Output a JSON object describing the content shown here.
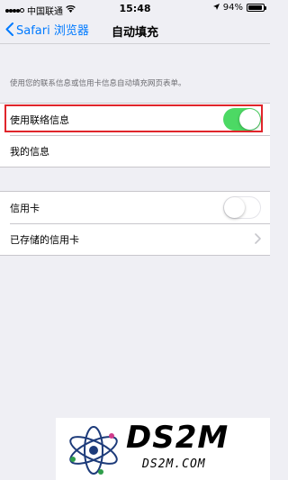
{
  "status": {
    "carrier": "中国联通",
    "time": "15:48",
    "battery_percent": "94%",
    "battery_level": 0.94
  },
  "nav": {
    "back_label": "Safari 浏览器",
    "title": "自动填充"
  },
  "description": "使用您的联系信息或信用卡信息自动填充网页表单。",
  "contact_group": {
    "use_contact_info": {
      "label": "使用联络信息",
      "toggle_on": true
    },
    "my_info": {
      "label": "我的信息"
    }
  },
  "card_group": {
    "credit_card": {
      "label": "信用卡",
      "toggle_on": false
    },
    "saved_cards": {
      "label": "已存储的信用卡"
    }
  },
  "watermark": {
    "title": "DS2M",
    "subtitle": "DS2M.COM"
  },
  "colors": {
    "accent": "#007aff",
    "toggle_on": "#4cd964",
    "highlight": "#e0252b",
    "background": "#efeff4"
  }
}
